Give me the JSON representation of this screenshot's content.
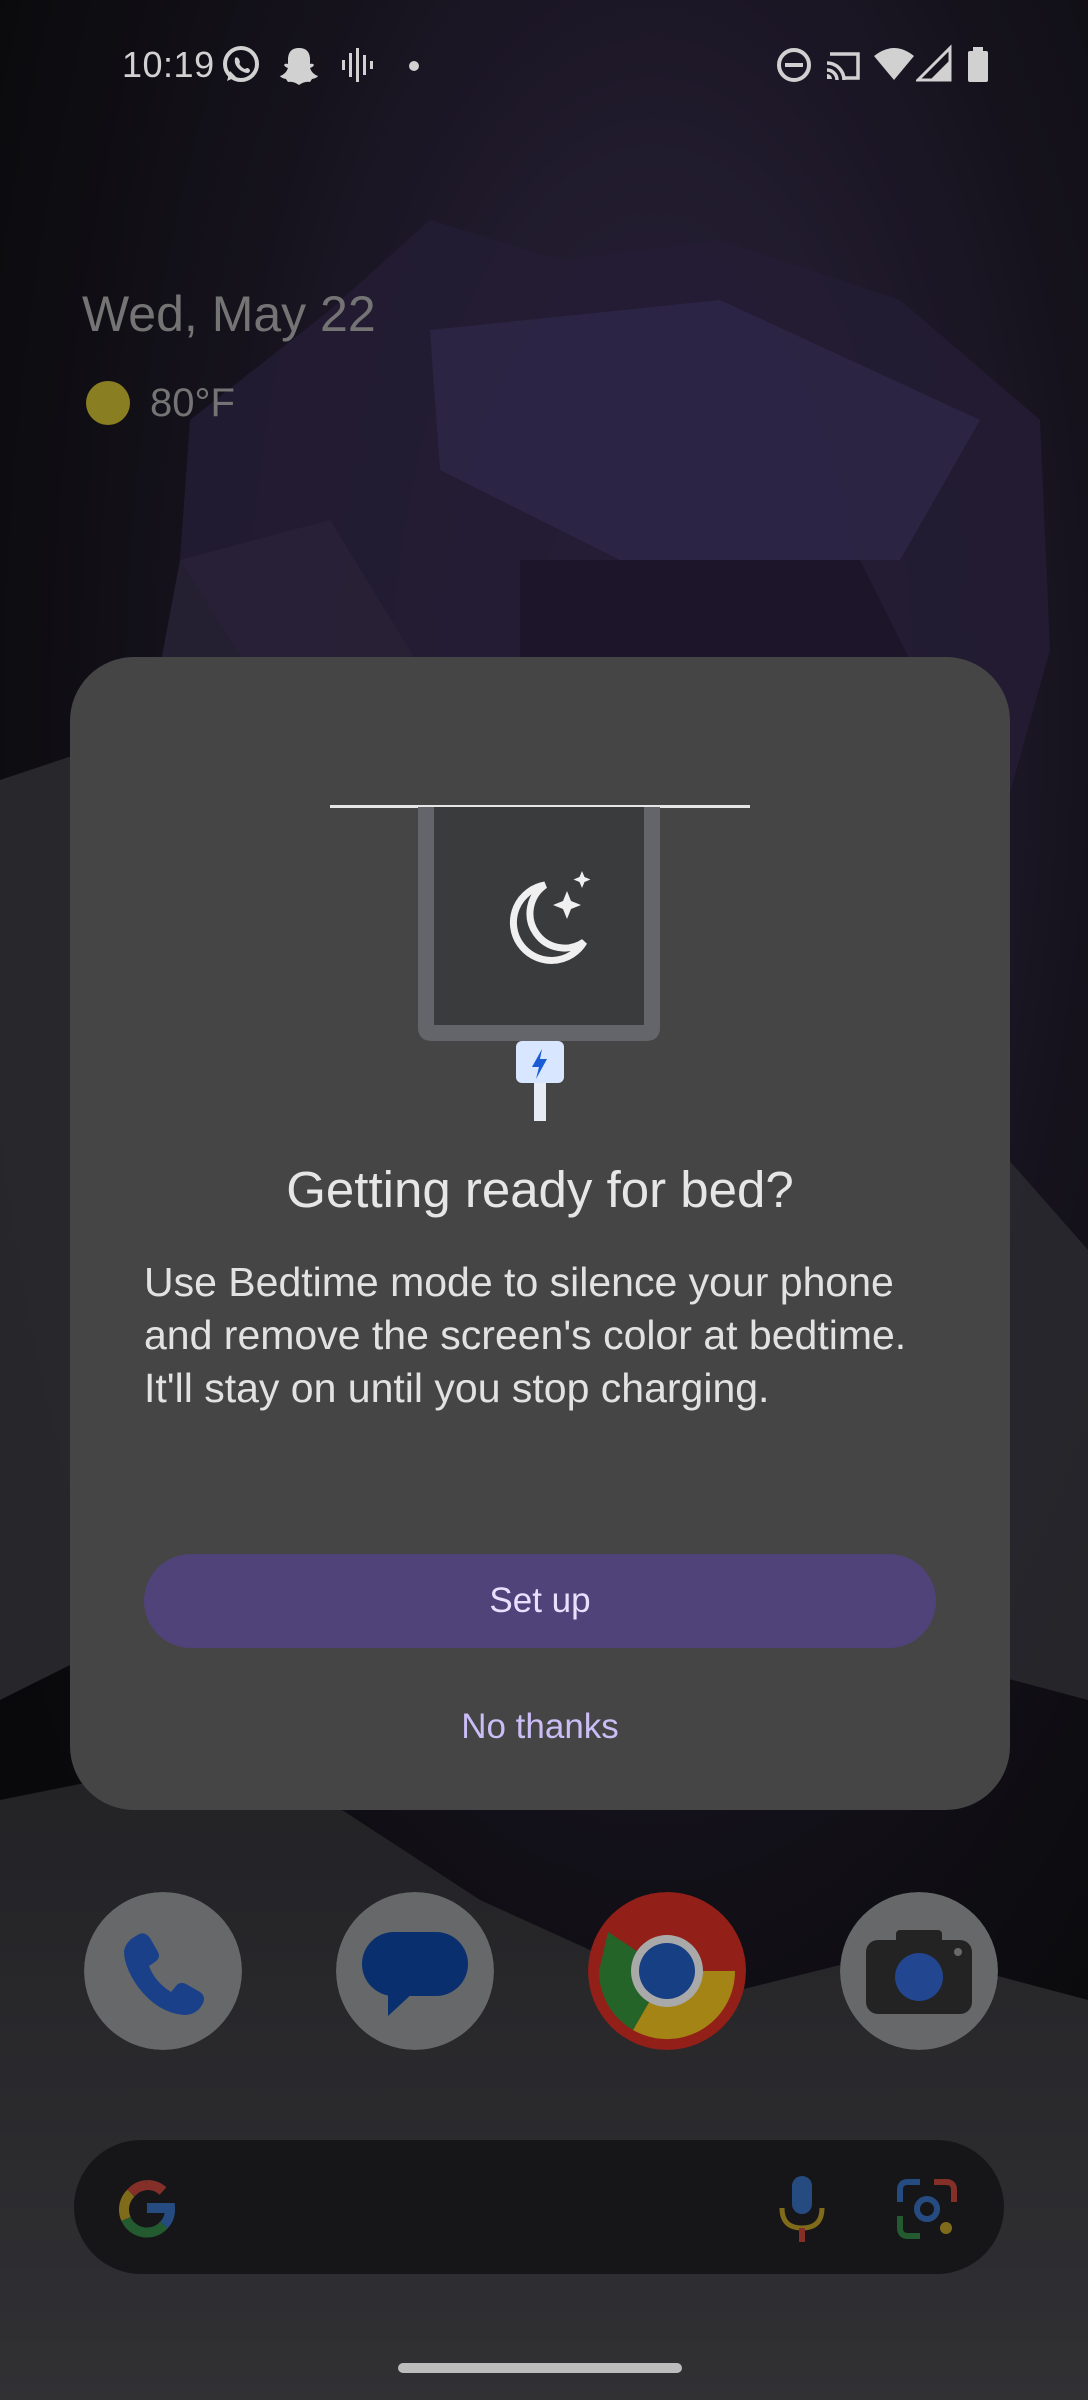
{
  "status_bar": {
    "time": "10:19",
    "left_icons": [
      "whatsapp-icon",
      "snapchat-icon",
      "voice-recorder-icon",
      "notification-dot-icon"
    ],
    "right_icons": [
      "do-not-disturb-icon",
      "cast-icon",
      "wifi-icon",
      "cellular-signal-icon",
      "battery-icon"
    ]
  },
  "glance": {
    "date": "Wed, May 22",
    "temperature": "80°F",
    "weather_icon": "sunny-icon"
  },
  "dialog": {
    "title": "Getting ready for bed?",
    "body": "Use Bedtime mode to silence your phone and remove the screen's color at bedtime. It'll stay on until you stop charging.",
    "primary_button": "Set up",
    "secondary_button": "No thanks",
    "illustration_icons": [
      "bedtime-moon-icon",
      "charging-bolt-icon"
    ]
  },
  "dock": {
    "apps": [
      "Phone",
      "Messages",
      "Chrome",
      "Camera"
    ]
  },
  "search": {
    "icons": [
      "google-g-icon",
      "microphone-icon",
      "google-lens-icon"
    ]
  },
  "colors": {
    "dialog_bg": "#454545",
    "primary_button_bg": "#4f437a",
    "accent_text": "#cbbdf5"
  }
}
